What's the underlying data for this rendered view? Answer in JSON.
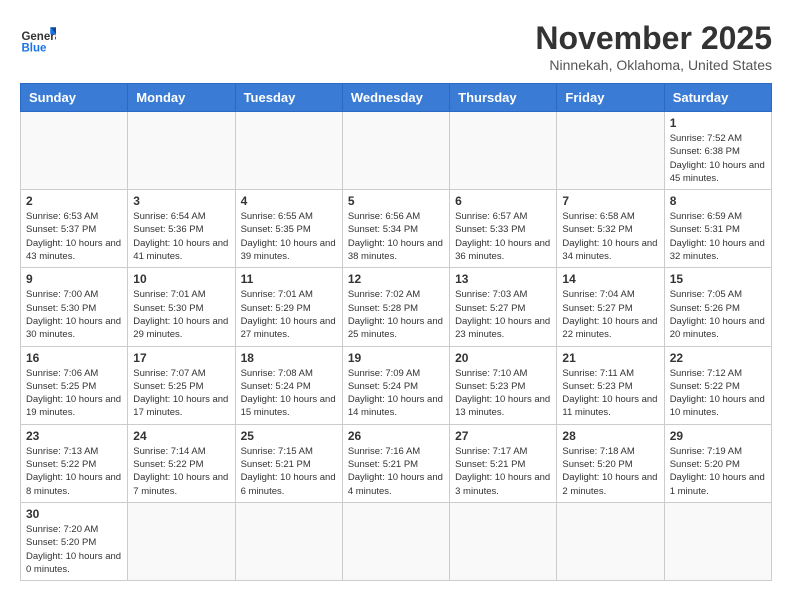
{
  "header": {
    "logo_general": "General",
    "logo_blue": "Blue",
    "month_title": "November 2025",
    "location": "Ninnekah, Oklahoma, United States"
  },
  "weekdays": [
    "Sunday",
    "Monday",
    "Tuesday",
    "Wednesday",
    "Thursday",
    "Friday",
    "Saturday"
  ],
  "weeks": [
    [
      {
        "day": "",
        "info": ""
      },
      {
        "day": "",
        "info": ""
      },
      {
        "day": "",
        "info": ""
      },
      {
        "day": "",
        "info": ""
      },
      {
        "day": "",
        "info": ""
      },
      {
        "day": "",
        "info": ""
      },
      {
        "day": "1",
        "info": "Sunrise: 7:52 AM\nSunset: 6:38 PM\nDaylight: 10 hours and 45 minutes."
      }
    ],
    [
      {
        "day": "2",
        "info": "Sunrise: 6:53 AM\nSunset: 5:37 PM\nDaylight: 10 hours and 43 minutes."
      },
      {
        "day": "3",
        "info": "Sunrise: 6:54 AM\nSunset: 5:36 PM\nDaylight: 10 hours and 41 minutes."
      },
      {
        "day": "4",
        "info": "Sunrise: 6:55 AM\nSunset: 5:35 PM\nDaylight: 10 hours and 39 minutes."
      },
      {
        "day": "5",
        "info": "Sunrise: 6:56 AM\nSunset: 5:34 PM\nDaylight: 10 hours and 38 minutes."
      },
      {
        "day": "6",
        "info": "Sunrise: 6:57 AM\nSunset: 5:33 PM\nDaylight: 10 hours and 36 minutes."
      },
      {
        "day": "7",
        "info": "Sunrise: 6:58 AM\nSunset: 5:32 PM\nDaylight: 10 hours and 34 minutes."
      },
      {
        "day": "8",
        "info": "Sunrise: 6:59 AM\nSunset: 5:31 PM\nDaylight: 10 hours and 32 minutes."
      }
    ],
    [
      {
        "day": "9",
        "info": "Sunrise: 7:00 AM\nSunset: 5:30 PM\nDaylight: 10 hours and 30 minutes."
      },
      {
        "day": "10",
        "info": "Sunrise: 7:01 AM\nSunset: 5:30 PM\nDaylight: 10 hours and 29 minutes."
      },
      {
        "day": "11",
        "info": "Sunrise: 7:01 AM\nSunset: 5:29 PM\nDaylight: 10 hours and 27 minutes."
      },
      {
        "day": "12",
        "info": "Sunrise: 7:02 AM\nSunset: 5:28 PM\nDaylight: 10 hours and 25 minutes."
      },
      {
        "day": "13",
        "info": "Sunrise: 7:03 AM\nSunset: 5:27 PM\nDaylight: 10 hours and 23 minutes."
      },
      {
        "day": "14",
        "info": "Sunrise: 7:04 AM\nSunset: 5:27 PM\nDaylight: 10 hours and 22 minutes."
      },
      {
        "day": "15",
        "info": "Sunrise: 7:05 AM\nSunset: 5:26 PM\nDaylight: 10 hours and 20 minutes."
      }
    ],
    [
      {
        "day": "16",
        "info": "Sunrise: 7:06 AM\nSunset: 5:25 PM\nDaylight: 10 hours and 19 minutes."
      },
      {
        "day": "17",
        "info": "Sunrise: 7:07 AM\nSunset: 5:25 PM\nDaylight: 10 hours and 17 minutes."
      },
      {
        "day": "18",
        "info": "Sunrise: 7:08 AM\nSunset: 5:24 PM\nDaylight: 10 hours and 15 minutes."
      },
      {
        "day": "19",
        "info": "Sunrise: 7:09 AM\nSunset: 5:24 PM\nDaylight: 10 hours and 14 minutes."
      },
      {
        "day": "20",
        "info": "Sunrise: 7:10 AM\nSunset: 5:23 PM\nDaylight: 10 hours and 13 minutes."
      },
      {
        "day": "21",
        "info": "Sunrise: 7:11 AM\nSunset: 5:23 PM\nDaylight: 10 hours and 11 minutes."
      },
      {
        "day": "22",
        "info": "Sunrise: 7:12 AM\nSunset: 5:22 PM\nDaylight: 10 hours and 10 minutes."
      }
    ],
    [
      {
        "day": "23",
        "info": "Sunrise: 7:13 AM\nSunset: 5:22 PM\nDaylight: 10 hours and 8 minutes."
      },
      {
        "day": "24",
        "info": "Sunrise: 7:14 AM\nSunset: 5:22 PM\nDaylight: 10 hours and 7 minutes."
      },
      {
        "day": "25",
        "info": "Sunrise: 7:15 AM\nSunset: 5:21 PM\nDaylight: 10 hours and 6 minutes."
      },
      {
        "day": "26",
        "info": "Sunrise: 7:16 AM\nSunset: 5:21 PM\nDaylight: 10 hours and 4 minutes."
      },
      {
        "day": "27",
        "info": "Sunrise: 7:17 AM\nSunset: 5:21 PM\nDaylight: 10 hours and 3 minutes."
      },
      {
        "day": "28",
        "info": "Sunrise: 7:18 AM\nSunset: 5:20 PM\nDaylight: 10 hours and 2 minutes."
      },
      {
        "day": "29",
        "info": "Sunrise: 7:19 AM\nSunset: 5:20 PM\nDaylight: 10 hours and 1 minute."
      }
    ],
    [
      {
        "day": "30",
        "info": "Sunrise: 7:20 AM\nSunset: 5:20 PM\nDaylight: 10 hours and 0 minutes."
      },
      {
        "day": "",
        "info": ""
      },
      {
        "day": "",
        "info": ""
      },
      {
        "day": "",
        "info": ""
      },
      {
        "day": "",
        "info": ""
      },
      {
        "day": "",
        "info": ""
      },
      {
        "day": "",
        "info": ""
      }
    ]
  ]
}
